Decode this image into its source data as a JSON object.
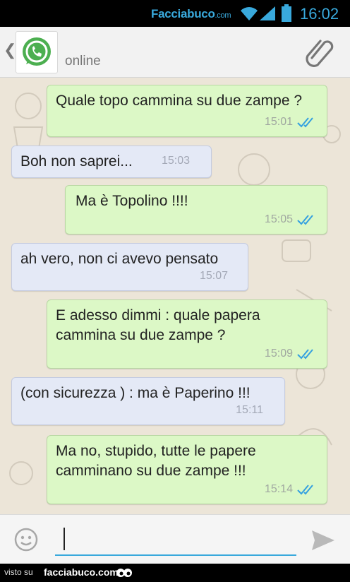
{
  "status_bar": {
    "watermark_main": "Facciabuco",
    "watermark_suffix": ".com",
    "time": "16:02"
  },
  "header": {
    "back_icon": "chevron-left-icon",
    "avatar_icon": "whatsapp-logo-icon",
    "contact_status": "online",
    "attach_icon": "paperclip-icon"
  },
  "messages": [
    {
      "direction": "out",
      "text": "Quale topo cammina su due zampe ?",
      "time": "15:01",
      "receipt": "double-check-blue"
    },
    {
      "direction": "in",
      "text": "Boh non saprei...",
      "time": "15:03"
    },
    {
      "direction": "out",
      "text": "Ma è Topolino !!!!",
      "time": "15:05",
      "receipt": "double-check-blue"
    },
    {
      "direction": "in",
      "text": "ah vero, non ci avevo pensato",
      "time": "15:07"
    },
    {
      "direction": "out",
      "text": "E adesso dimmi : quale papera cammina su due zampe ?",
      "time": "15:09",
      "receipt": "double-check-blue"
    },
    {
      "direction": "in",
      "text": "(con sicurezza ) : ma è Paperino !!!",
      "time": "15:11"
    },
    {
      "direction": "out",
      "text": "Ma no, stupido, tutte le papere camminano su due zampe !!!",
      "time": "15:14",
      "receipt": "double-check-blue"
    }
  ],
  "composer": {
    "emoji_icon": "smiley-icon",
    "input_value": "",
    "send_icon": "send-arrow-icon"
  },
  "footer": {
    "visto_label": "visto su",
    "site_label": "facciabuco.com"
  },
  "colors": {
    "outgoing_bubble": "#dcf8c6",
    "incoming_bubble": "#e4e9f6",
    "read_receipt": "#34a0e0",
    "accent": "#39a9dc"
  }
}
